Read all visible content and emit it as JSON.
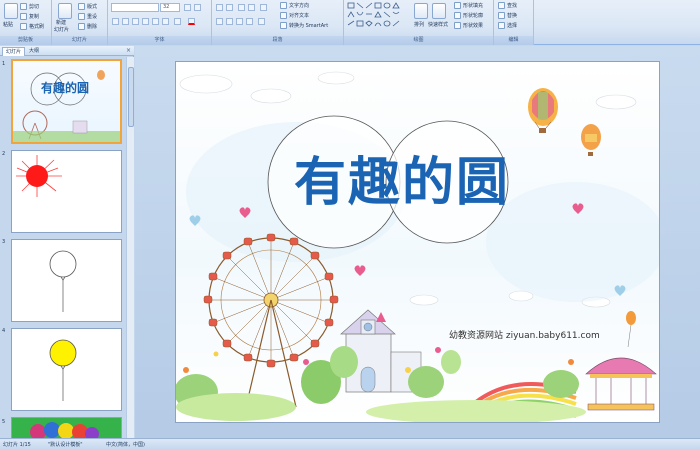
{
  "ribbon": {
    "clipboard": {
      "group_label": "剪贴板",
      "paste": "粘贴",
      "cut": "剪切",
      "copy": "复制",
      "format_painter": "格式刷"
    },
    "slides": {
      "group_label": "幻灯片",
      "new_slide_line1": "新建",
      "new_slide_line2": "幻灯片",
      "layout": "版式",
      "reset": "重设",
      "delete": "删除"
    },
    "font": {
      "group_label": "字体",
      "font_name": "",
      "font_size": "32"
    },
    "paragraph": {
      "group_label": "段落",
      "text_direction": "文字方向",
      "align_text": "对齐文本",
      "convert_smartart": "转换为 SmartArt"
    },
    "drawing": {
      "group_label": "绘图",
      "arrange": "排列",
      "quick_styles": "快速样式",
      "shape_fill": "形状填充",
      "shape_outline": "形状轮廓",
      "shape_effects": "形状效果"
    },
    "editing": {
      "group_label": "编辑",
      "find": "查找",
      "replace": "替换",
      "select": "选择"
    }
  },
  "pane": {
    "tab_slides": "幻灯片",
    "tab_outline": "大纲",
    "close": "×",
    "thumb_numbers": [
      "1",
      "2",
      "3",
      "4",
      "5"
    ]
  },
  "slide": {
    "title": "有趣的圆",
    "watermark": "幼教资源网站  ziyuan.baby611.com",
    "thumb_title": "有趣的圆"
  },
  "status": {
    "slide_count": "幻灯片 1/15",
    "theme": "\"默认设计模板\"",
    "language": "中文(简体，中国)"
  },
  "colors": {
    "title_blue": "#1a64b3",
    "selected_border": "#f2a33a",
    "sun_red": "#ff1a1a",
    "balloon_yellow": "#fff200"
  }
}
